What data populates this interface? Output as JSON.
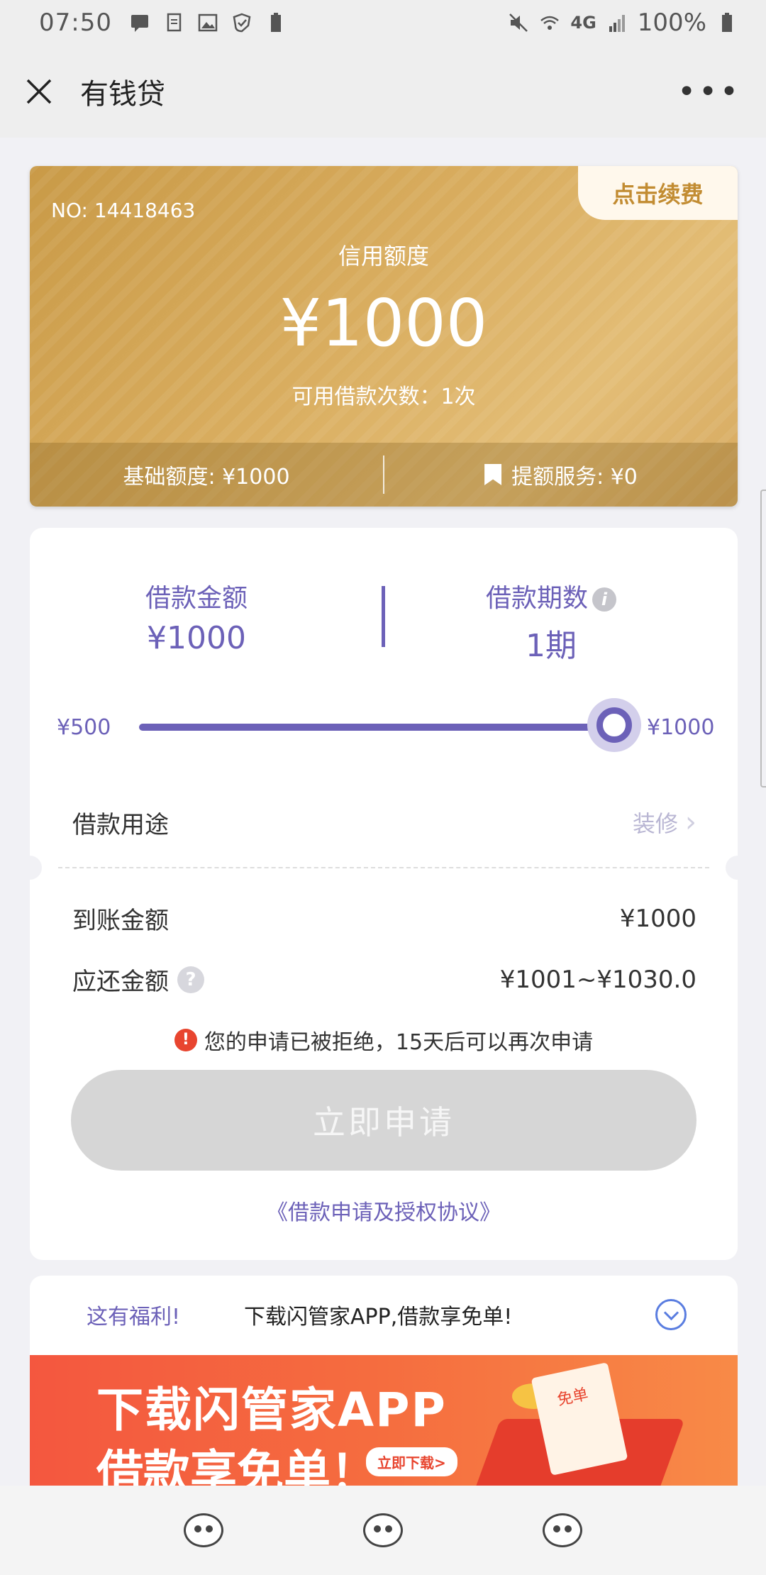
{
  "status_bar": {
    "time": "07:50",
    "battery": "100%",
    "network": "4G"
  },
  "app_bar": {
    "title": "有钱贷",
    "more": "•••"
  },
  "credit_card": {
    "renew_label": "点击续费",
    "number": "NO: 14418463",
    "limit_label": "信用额度",
    "limit_amount": "¥1000",
    "available_times": "可用借款次数：1次",
    "base_limit": "基础额度: ¥1000",
    "boost_service": "提额服务: ¥0"
  },
  "loan": {
    "amount_label": "借款金额",
    "amount_value": "¥1000",
    "period_label": "借款期数",
    "period_value": "1期",
    "slider_min": "¥500",
    "slider_max": "¥1000",
    "slider_level": 1.0,
    "purpose_label": "借款用途",
    "purpose_value": "装修",
    "received_label": "到账金额",
    "received_value": "¥1000",
    "repay_label": "应还金额",
    "repay_value": "¥1001~¥1030.0",
    "rejection_notice": "您的申请已被拒绝，15天后可以再次申请",
    "apply_button": "立即申请",
    "agreement_link": "《借款申请及授权协议》"
  },
  "promo": {
    "tag": "这有福利!",
    "message": "下载闪管家APP,借款享免单!",
    "banner_line1": "下载闪管家APP",
    "banner_line2": "借款享免单！",
    "banner_button": "立即下载>",
    "banner_badge": "免单"
  },
  "colors": {
    "accent": "#6c61b8",
    "gold": "#d9ad5f",
    "danger": "#e8452f"
  }
}
